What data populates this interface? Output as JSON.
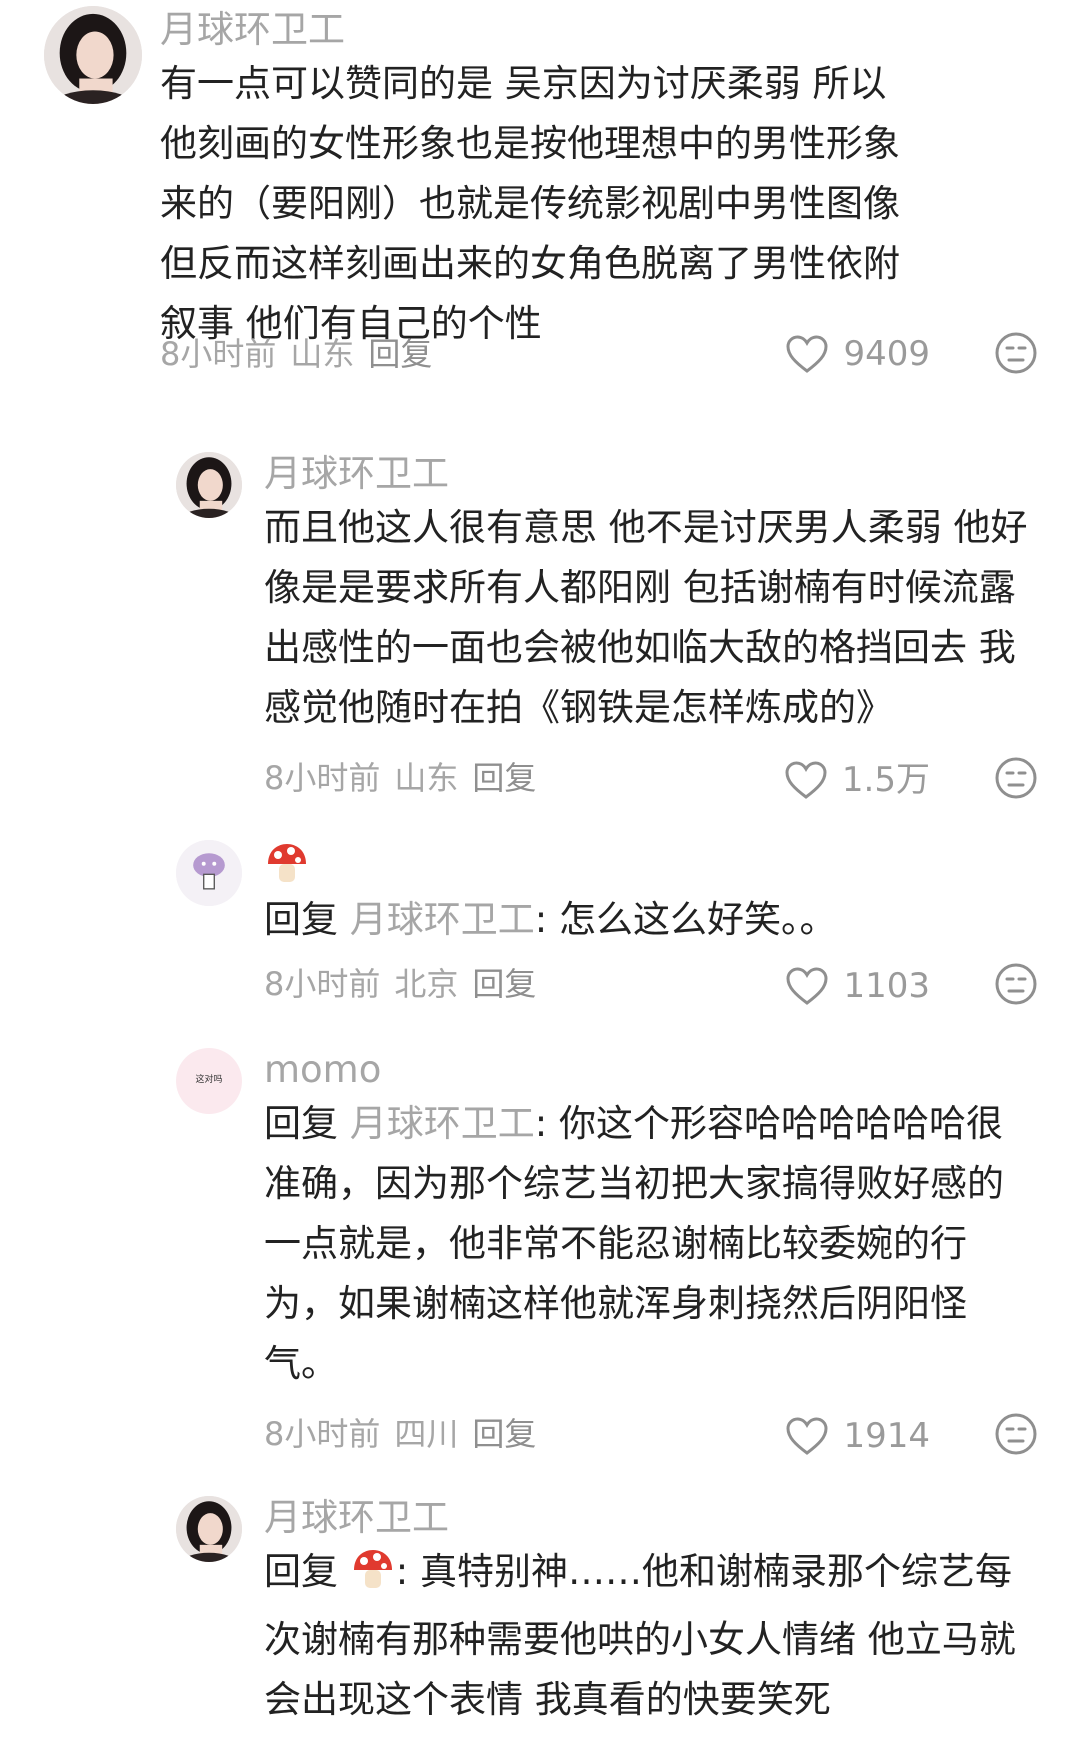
{
  "comments": [
    {
      "username": "月球环卫工",
      "text": "有一点可以赞同的是 吴京因为讨厌柔弱 所以他刻画的女性形象也是按他理想中的男性形象来的（要阳刚）也就是传统影视剧中男性图像 但反而这样刻画出来的女角色脱离了男性依附叙事 他们有自己的个性",
      "time": "8小时前",
      "location": "山东",
      "reply_label": "回复",
      "likes": "9409"
    },
    {
      "username": "月球环卫工",
      "text": "而且他这人很有意思 他不是讨厌男人柔弱 他好像是是要求所有人都阳刚 包括谢楠有时候流露出感性的一面也会被他如临大敌的格挡回去 我感觉他随时在拍《钢铁是怎样炼成的》",
      "time": "8小时前",
      "location": "山东",
      "reply_label": "回复",
      "likes": "1.5万"
    },
    {
      "username": "",
      "username_icon": "mushroom-emoji",
      "reply_prefix": "回复",
      "mention": "月球环卫工",
      "text": ": 怎么这么好笑。。",
      "time": "8小时前",
      "location": "北京",
      "reply_label": "回复",
      "likes": "1103"
    },
    {
      "username": "momo",
      "avatar_text": "这对吗",
      "reply_prefix": "回复",
      "mention": "月球环卫工",
      "text": ": 你这个形容哈哈哈哈哈哈很准确，因为那个综艺当初把大家搞得败好感的一点就是，他非常不能忍谢楠比较委婉的行为，如果谢楠这样他就浑身刺挠然后阴阳怪气。",
      "time": "8小时前",
      "location": "四川",
      "reply_label": "回复",
      "likes": "1914"
    },
    {
      "username": "月球环卫工",
      "reply_prefix": "回复",
      "mention_icon": "mushroom-emoji",
      "text": ": 真特别神……他和谢楠录那个综艺每次谢楠有那种需要他哄的小女人情绪 他立马就会出现这个表情 我真看的快要笑死"
    }
  ],
  "colors": {
    "text": "#222222",
    "muted": "#a6a6a6",
    "icon": "#9a9a9a"
  }
}
